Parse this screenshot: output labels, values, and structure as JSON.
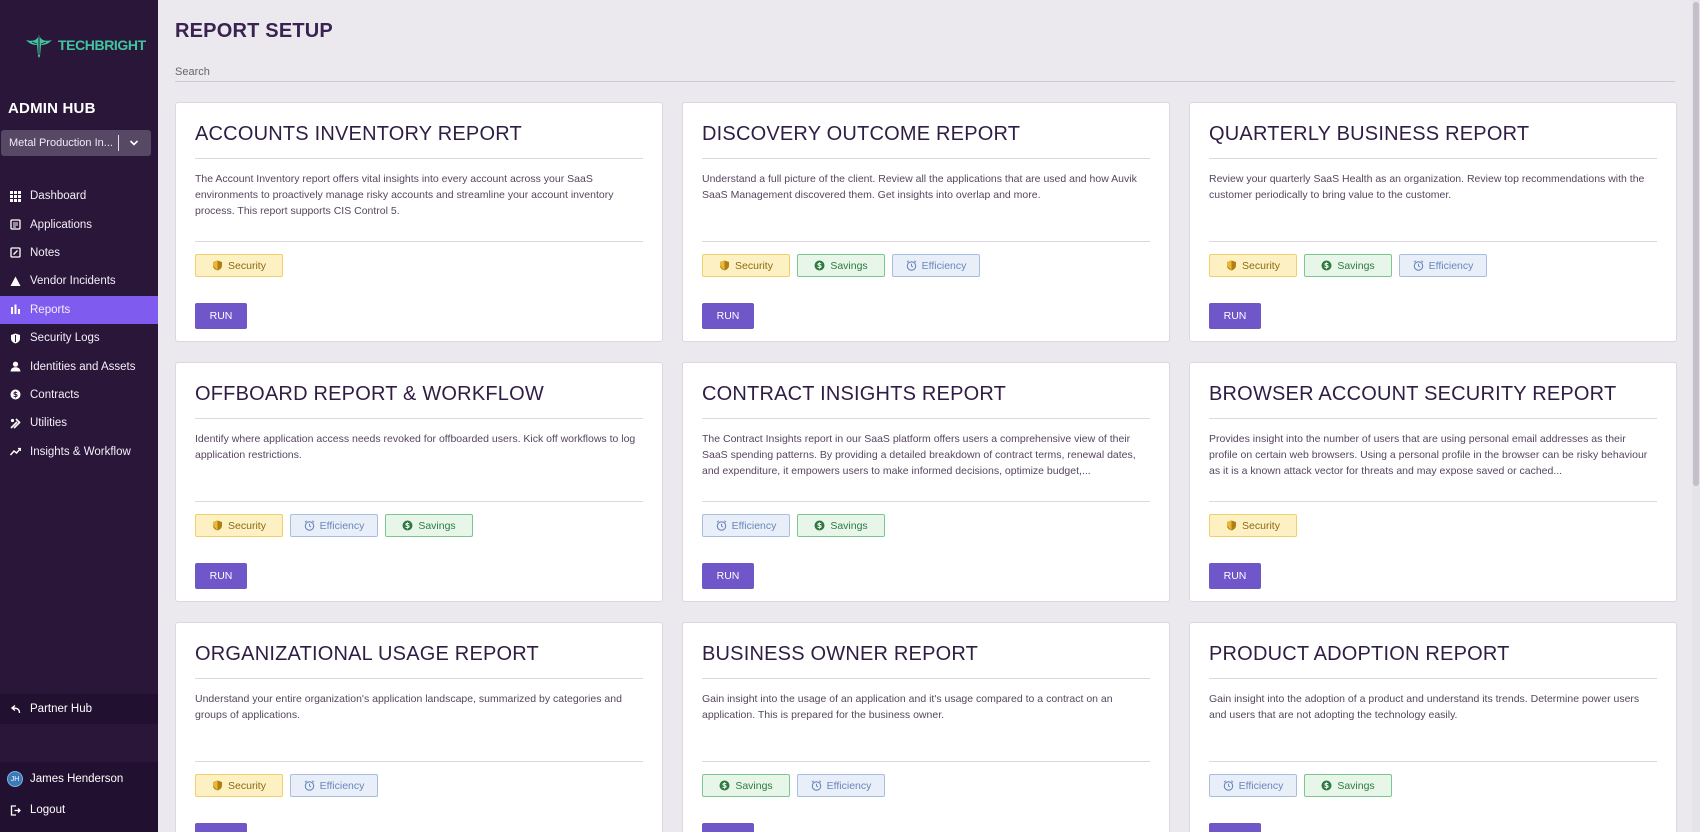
{
  "sidebar": {
    "brand": "TECHBRIGHT",
    "hub_title": "ADMIN HUB",
    "org_selected": "Metal Production In...",
    "nav": [
      {
        "label": "Dashboard",
        "icon": "grid-icon"
      },
      {
        "label": "Applications",
        "icon": "applications-icon"
      },
      {
        "label": "Notes",
        "icon": "notes-icon"
      },
      {
        "label": "Vendor Incidents",
        "icon": "warning-icon"
      },
      {
        "label": "Reports",
        "icon": "bar-chart-icon"
      },
      {
        "label": "Security Logs",
        "icon": "shield-icon"
      },
      {
        "label": "Identities and Assets",
        "icon": "person-icon"
      },
      {
        "label": "Contracts",
        "icon": "dollar-icon"
      },
      {
        "label": "Utilities",
        "icon": "tools-icon"
      },
      {
        "label": "Insights & Workflow",
        "icon": "trend-icon"
      }
    ],
    "partner_hub": "Partner Hub",
    "user_initials": "JH",
    "user_name": "James Henderson",
    "logout": "Logout"
  },
  "main": {
    "title": "REPORT SETUP",
    "search_placeholder": "Search",
    "run_label": "RUN",
    "cards": [
      {
        "title": "ACCOUNTS INVENTORY REPORT",
        "description": "The Account Inventory report offers vital insights into every account across your SaaS environments to proactively manage risky accounts and streamline your account inventory process. This report supports CIS Control 5.",
        "tags": [
          "Security"
        ]
      },
      {
        "title": "DISCOVERY OUTCOME REPORT",
        "description": "Understand a full picture of the client. Review all the applications that are used and how Auvik SaaS Management discovered them. Get insights into overlap and more.",
        "tags": [
          "Security",
          "Savings",
          "Efficiency"
        ]
      },
      {
        "title": "QUARTERLY BUSINESS REPORT",
        "description": "Review your quarterly SaaS Health as an organization. Review top recommendations with the customer periodically to bring value to the customer.",
        "tags": [
          "Security",
          "Savings",
          "Efficiency"
        ]
      },
      {
        "title": "OFFBOARD REPORT & WORKFLOW",
        "description": "Identify where application access needs revoked for offboarded users. Kick off workflows to log application restrictions.",
        "tags": [
          "Security",
          "Efficiency",
          "Savings"
        ]
      },
      {
        "title": "CONTRACT INSIGHTS REPORT",
        "description": "The Contract Insights report in our SaaS platform offers users a comprehensive view of their SaaS spending patterns. By providing a detailed breakdown of contract terms, renewal dates, and expenditure, it empowers users to make informed decisions, optimize budget,...",
        "tags": [
          "Efficiency",
          "Savings"
        ]
      },
      {
        "title": "BROWSER ACCOUNT SECURITY REPORT",
        "description": "Provides insight into the number of users that are using personal email addresses as their profile on certain web browsers. Using a personal profile in the browser can be risky behaviour as it is a known attack vector for threats and may expose saved or cached...",
        "tags": [
          "Security"
        ]
      },
      {
        "title": "ORGANIZATIONAL USAGE REPORT",
        "description": "Understand your entire organization's application landscape, summarized by categories and groups of applications.",
        "tags": [
          "Security",
          "Efficiency"
        ]
      },
      {
        "title": "BUSINESS OWNER REPORT",
        "description": "Gain insight into the usage of an application and it's usage compared to a contract on an application. This is prepared for the business owner.",
        "tags": [
          "Savings",
          "Efficiency"
        ]
      },
      {
        "title": "PRODUCT ADOPTION REPORT",
        "description": "Gain insight into the adoption of a product and understand its trends. Determine power users and users that are not adopting the technology easily.",
        "tags": [
          "Efficiency",
          "Savings"
        ]
      }
    ]
  },
  "colors": {
    "sidebar_bg": "#2a1638",
    "active_nav": "#7f5bf0",
    "run_button": "#6f57c9",
    "security": "#fdf1c4",
    "savings": "#e8f6ea",
    "efficiency": "#e9eff9"
  }
}
